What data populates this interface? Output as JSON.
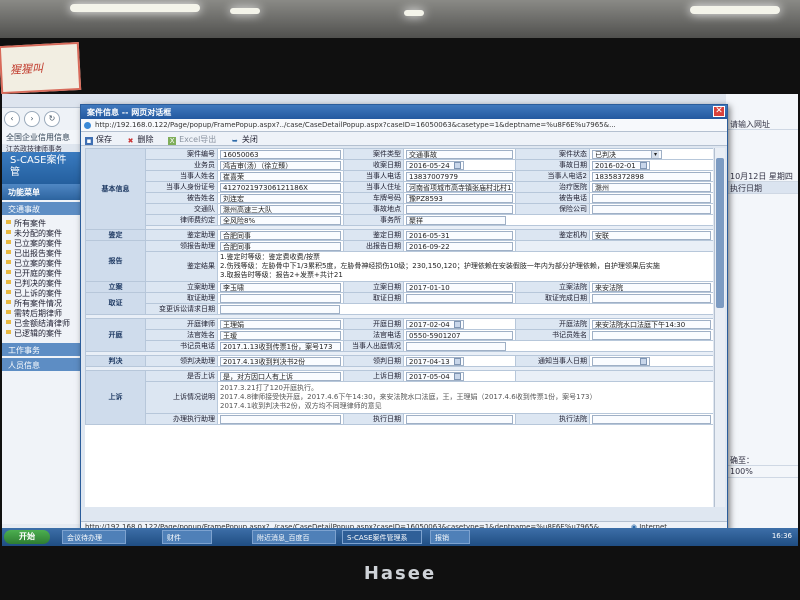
{
  "sticky_note": "猩猩叫",
  "laptop_brand": "Hasee",
  "background": {
    "favorites_bar": "全国企业信用信息",
    "app_brand": "S-CASE案件管",
    "app_sub": "江苏政技律师事务",
    "menu_header": "功能菜单",
    "menu_section": "交通事故",
    "menu_items": [
      "所有案件",
      "未分配的案件",
      "已立案的案件",
      "已出报告案件",
      "已立案的案件",
      "已开庭的案件",
      "已判决的案件",
      "已上诉的案件",
      "所有案件情况",
      "需转后期律师",
      "已金额结清律师",
      "已逻辑的案件"
    ],
    "sections": [
      "工作事务",
      "人员信息"
    ],
    "right_pane": {
      "search_hint": "请输入网址",
      "date_label": "10月12日 星期四",
      "column": "执行日期",
      "status": "确至：",
      "zoom": "100%"
    }
  },
  "taskbar": {
    "start": "开始",
    "items": [
      "会议待办理",
      "财件",
      "附近消息_百度百",
      "S-CASE案件管理系",
      "报销"
    ],
    "clock": "16:36"
  },
  "window": {
    "title": "案件信息 -- 网页对话框",
    "address": "http://192.168.0.122/Page/popup/FramePopup.aspx?../case/CaseDetailPopup.aspx?caseID=16050063&casetype=1&deptname=%u8F6E%u7965&...",
    "toolbar": {
      "save": "保存",
      "delete": "删除",
      "export": "Excel导出",
      "close": "关闭"
    },
    "status_url": "http://192.168.0.122/Page/popup/FramePopup.aspx?../case/CaseDetailPopup.aspx?caseID=16050063&casetype=1&deptname=%u8F6E%u7965&",
    "status_zone": "Internet"
  },
  "form": {
    "sections": {
      "basic": "基本信息",
      "appraisal": "鉴定",
      "report": "报告",
      "filing": "立案",
      "evidence": "取证",
      "hearing": "开庭",
      "judgment": "判决",
      "appeal": "上诉"
    },
    "basic": {
      "case_no_label": "案件编号",
      "case_no": "16050063",
      "case_type_label": "案件类型",
      "case_type": "交通事故",
      "case_status_label": "案件状态",
      "case_status": "已判决",
      "business_label": "业务员",
      "business": "鸿吉审(汤）（徐立臻）",
      "receive_date_label": "收案日期",
      "receive_date": "2016-05-24",
      "accident_date_label": "事故日期",
      "accident_date": "2016-02-01",
      "party_name_label": "当事人姓名",
      "party_name": "崔喜荣",
      "party_phone_label": "当事人电话",
      "party_phone": "13837007979",
      "party_phone2_label": "当事人电话2",
      "party_phone2": "18358372898",
      "party_id_label": "当事人身份证号",
      "party_id": "412702197306121186X",
      "party_addr_label": "当事人住址",
      "party_addr": "河南省项城市高寺镇张庙村北村12号院",
      "hospital_label": "治疗医院",
      "hospital": "滁州",
      "defendant_label": "被告姓名",
      "defendant": "刘连宏",
      "plate_label": "车牌号码",
      "plate": "豫PZ8593",
      "defendant_phone_label": "被告电话",
      "defendant_phone": "",
      "police_label": "交通队",
      "police": "滁州高速三大队",
      "accident_place_label": "事故地点",
      "accident_place": "",
      "insurer_label": "保险公司",
      "insurer": "",
      "fee_label": "律师费约定",
      "fee": "全风险8%",
      "office_label": "事务所",
      "office": "聚祥"
    },
    "appraisal": {
      "assistant_label": "鉴定助理",
      "assistant": "合肥同事",
      "date_label": "鉴定日期",
      "date": "2016-05-31",
      "agency_label": "鉴定机构",
      "agency": "安联"
    },
    "report": {
      "assistant_label": "领报告助理",
      "assistant": "合肥同事",
      "date_label": "出报告日期",
      "date": "2016-09-22",
      "result_label": "鉴定结果",
      "result_lines": [
        "1.鉴定时等级：鉴定费收费/按票",
        "2.伤残等级：左胁骨中下1/3累积5度，左胁骨神经损伤10级；230,150,120；护理依赖在安装假肢一年内为部分护理依赖，自护理领果后实施",
        "3.取报告时等级：报告2+发票+共计21"
      ]
    },
    "filing": {
      "assistant_label": "立案助理",
      "assistant": "李玉啸",
      "date_label": "立案日期",
      "date": "2017-01-10",
      "court_label": "立案法院",
      "court": "来安法院"
    },
    "evidence": {
      "assistant_label": "取证助理",
      "assistant": "",
      "date_label": "取证日期",
      "date": "",
      "done_date_label": "取证完成日期",
      "done_date": "",
      "apply_label": "变更诉讼请求日期",
      "apply": ""
    },
    "hearing": {
      "lawyer_label": "开庭律师",
      "lawyer": "王理娟",
      "date_label": "开庭日期",
      "date": "2017-02-04",
      "court_label": "开庭法院",
      "court": "来安法院水口法庭下午14:30",
      "judge_label": "法官姓名",
      "judge": "王瑷",
      "judge_phone_label": "法官电话",
      "judge_phone": "0550-5901207",
      "clerk_label": "书记员姓名",
      "clerk": "",
      "clerk_phone_label": "书记员电话",
      "clerk_phone": "2017.1.13收到传票1份，案号173",
      "party_attend_label": "当事人出庭情况",
      "party_attend": ""
    },
    "judgment": {
      "assistant_label": "领判决助理",
      "assistant": "2017.4.13收到判决书2份",
      "date_label": "领判日期",
      "date": "2017-04-13",
      "notify_label": "通知当事人日期",
      "notify": ""
    },
    "appeal": {
      "is_label": "是否上诉",
      "is": "是，对方因口人有上诉",
      "date_label": "上诉日期",
      "date": "2017-05-04",
      "desc_label": "上诉情况说明",
      "desc_lines": [
        "2017.3.21打了120开庭执行。",
        "2017.4.8律师接受快开庭，2017.4.6下午14:30，来安法院水口法庭，王，王理娟（2017.4.6收到传票1份，案号173）",
        "2017.4.1收到判决书2份，双方均不同理律师的意见"
      ],
      "exec_assistant_label": "办理执行助理",
      "exec_assistant": "",
      "exec_date_label": "执行日期",
      "exec_date": "",
      "exec_court_label": "执行法院",
      "exec_court": ""
    }
  }
}
